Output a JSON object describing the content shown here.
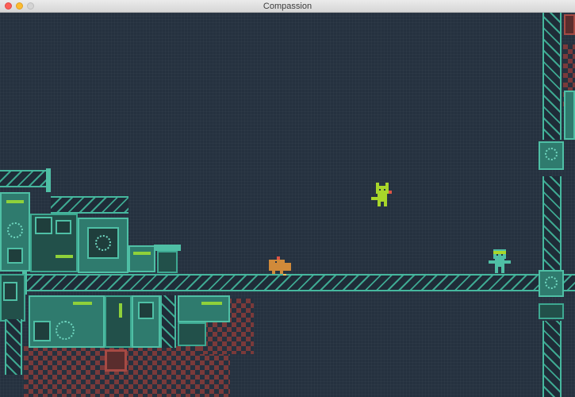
{
  "window": {
    "title": "Compassion"
  },
  "icons": {
    "close": "close-button-icon",
    "minimize": "minimize-button-icon",
    "zoom": "zoom-button-icon"
  },
  "colors": {
    "background": "#25313f",
    "pipe": "#46b79e",
    "panel": "#2f7b6e",
    "rust": "#7a3a3a",
    "cat": "#a8d62a",
    "robot": "#4fbfa5",
    "dog": "#d08a3a"
  }
}
